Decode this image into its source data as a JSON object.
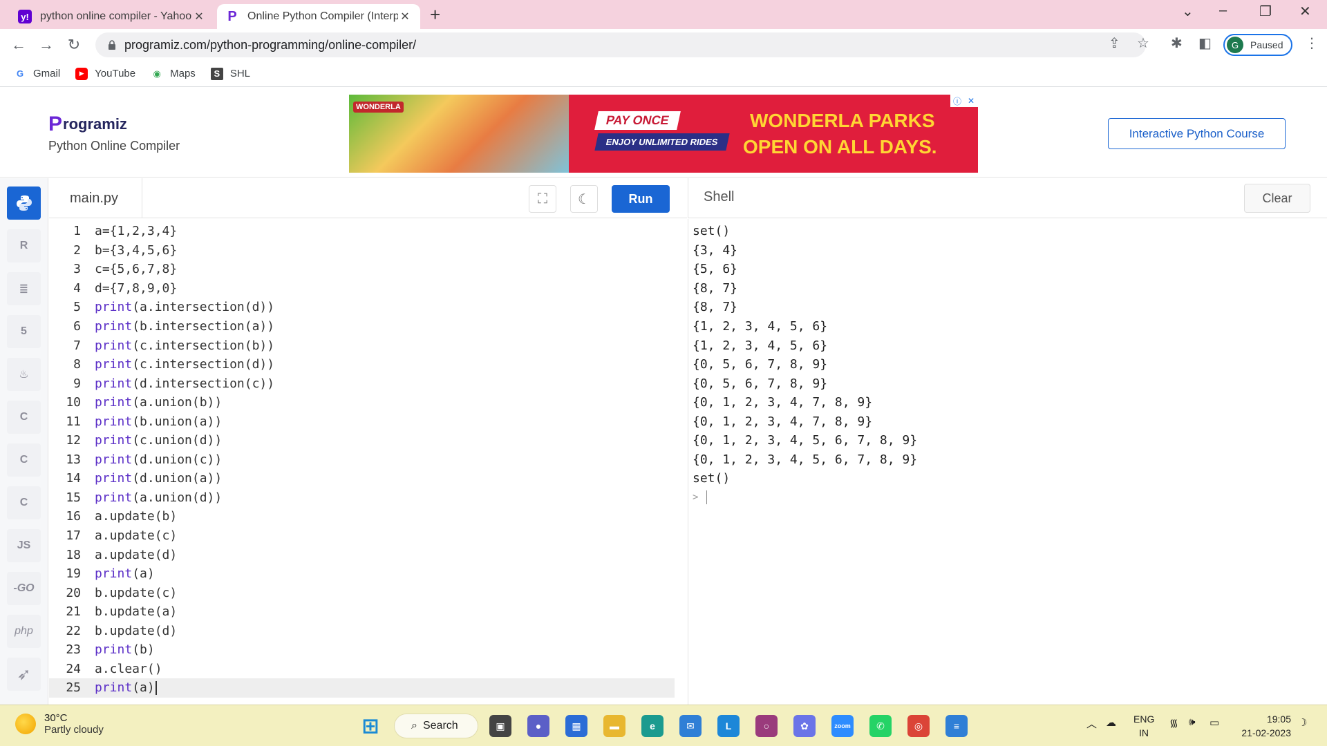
{
  "browser": {
    "tabs": [
      {
        "title": "python online compiler - Yahoo Search Results",
        "icon": "yahoo-icon",
        "color": "#6001d2",
        "glyph": "y!"
      },
      {
        "title": "Online Python Compiler (Interpreter)",
        "icon": "programiz-icon",
        "color": "#6b27d6",
        "glyph": "P"
      }
    ],
    "new_tab": "+",
    "url": "programiz.com/python-programming/online-compiler/",
    "profile_initial": "G",
    "profile_status": "Paused",
    "bookmarks": [
      {
        "label": "Gmail",
        "icon": "google-icon",
        "color": "#4285f4",
        "glyph": "G"
      },
      {
        "label": "YouTube",
        "icon": "youtube-icon",
        "color": "#ff0000",
        "glyph": "▶"
      },
      {
        "label": "Maps",
        "icon": "maps-pin-icon",
        "color": "#34a853",
        "glyph": "◉"
      },
      {
        "label": "SHL",
        "icon": "shl-icon",
        "color": "#444444",
        "glyph": "S"
      }
    ]
  },
  "site": {
    "logo_text": "rogramiz",
    "logo_mark": "P",
    "subtitle": "Python Online Compiler",
    "course_button": "Interactive Python Course",
    "ad": {
      "brand": "WONDERLA",
      "pay_once": "PAY ONCE",
      "enjoy": "ENJOY UNLIMITED RIDES",
      "headline_1": "WONDERLA PARKS",
      "headline_2": "OPEN ON ALL DAYS."
    }
  },
  "languages": [
    {
      "name": "python",
      "label": "",
      "active": true
    },
    {
      "name": "r",
      "label": "R"
    },
    {
      "name": "sql",
      "label": "≣"
    },
    {
      "name": "html",
      "label": "5"
    },
    {
      "name": "java",
      "label": "♨"
    },
    {
      "name": "c",
      "label": "C"
    },
    {
      "name": "cpp",
      "label": "C"
    },
    {
      "name": "csharp",
      "label": "C"
    },
    {
      "name": "js",
      "label": "JS"
    },
    {
      "name": "go",
      "label": "-GO"
    },
    {
      "name": "php",
      "label": "php"
    },
    {
      "name": "swift",
      "label": "➶"
    }
  ],
  "editor": {
    "file_name": "main.py",
    "run_label": "Run",
    "current_line": 25,
    "lines": [
      "a={1,2,3,4}",
      "b={3,4,5,6}",
      "c={5,6,7,8}",
      "d={7,8,9,0}",
      "print(a.intersection(d))",
      "print(b.intersection(a))",
      "print(c.intersection(b))",
      "print(c.intersection(d))",
      "print(d.intersection(c))",
      "print(a.union(b))",
      "print(b.union(a))",
      "print(c.union(d))",
      "print(d.union(c))",
      "print(d.union(a))",
      "print(a.union(d))",
      "a.update(b)",
      "a.update(c)",
      "a.update(d)",
      "print(a)",
      "b.update(c)",
      "b.update(a)",
      "b.update(d)",
      "print(b)",
      "a.clear()",
      "print(a)"
    ]
  },
  "shell": {
    "title": "Shell",
    "clear_label": "Clear",
    "prompt": ">",
    "output": [
      "set()",
      "{3, 4}",
      "{5, 6}",
      "{8, 7}",
      "{8, 7}",
      "{1, 2, 3, 4, 5, 6}",
      "{1, 2, 3, 4, 5, 6}",
      "{0, 5, 6, 7, 8, 9}",
      "{0, 5, 6, 7, 8, 9}",
      "{0, 1, 2, 3, 4, 7, 8, 9}",
      "{0, 1, 2, 3, 4, 7, 8, 9}",
      "{0, 1, 2, 3, 4, 5, 6, 7, 8, 9}",
      "{0, 1, 2, 3, 4, 5, 6, 7, 8, 9}",
      "set()"
    ]
  },
  "taskbar": {
    "temperature": "30°C",
    "weather": "Partly cloudy",
    "search_label": "Search",
    "language": "ENG",
    "region": "IN",
    "time": "19:05",
    "date": "21-02-2023",
    "apps": [
      {
        "name": "windows-start-icon",
        "color": "#1a8ad4",
        "glyph": "⊞"
      },
      {
        "name": "task-view-icon",
        "color": "#444444",
        "glyph": "▣"
      },
      {
        "name": "teams-chat-icon",
        "color": "#5b5fc7",
        "glyph": "●"
      },
      {
        "name": "microsoft-store-icon",
        "color": "#2b6cd6",
        "glyph": "▦"
      },
      {
        "name": "file-explorer-icon",
        "color": "#e8b730",
        "glyph": "▬"
      },
      {
        "name": "edge-icon",
        "color": "#1b9b8f",
        "glyph": "e"
      },
      {
        "name": "mail-icon",
        "color": "#2f7fd6",
        "glyph": "✉"
      },
      {
        "name": "l-app-icon",
        "color": "#1d87d8",
        "glyph": "L"
      },
      {
        "name": "media-app-icon",
        "color": "#9a3b7c",
        "glyph": "○"
      },
      {
        "name": "photos-icon",
        "color": "#6a74e8",
        "glyph": "✿"
      },
      {
        "name": "zoom-icon",
        "color": "#2d8cff",
        "glyph": "zoom"
      },
      {
        "name": "whatsapp-icon",
        "color": "#25d366",
        "glyph": "✆"
      },
      {
        "name": "chrome-icon",
        "color": "#db4437",
        "glyph": "◎"
      },
      {
        "name": "notepad-icon",
        "color": "#2f7fd6",
        "glyph": "≡"
      }
    ]
  }
}
